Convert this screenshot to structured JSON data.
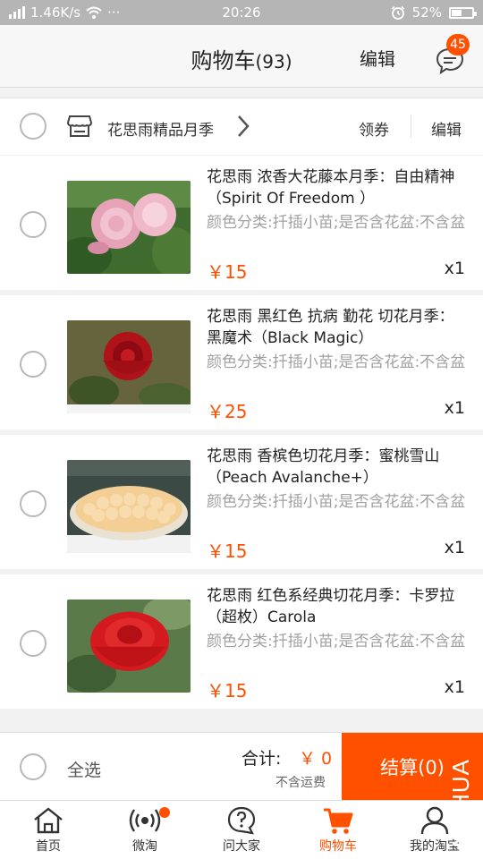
{
  "status_bar": {
    "network_speed": "1.46K/s",
    "dots": "···",
    "time": "20:26",
    "battery_percent": "52%",
    "battery_level": 0.52,
    "icons": [
      "signal-icon",
      "wifi-icon",
      "alarm-icon",
      "battery-icon"
    ]
  },
  "header": {
    "title": "购物车",
    "count": "(93)",
    "edit_label": "编辑",
    "message_badge": "45"
  },
  "shop": {
    "name": "花思雨精品月季",
    "coupon_label": "领券",
    "edit_label": "编辑"
  },
  "items": [
    {
      "title": "花思雨 浓香大花藤本月季：自由精神（Spirit Of Freedom ）",
      "sku": "颜色分类:扦插小苗;是否含花盆:不含盆",
      "price": "￥15",
      "qty": "x1",
      "image": "pink-rose-photo"
    },
    {
      "title": "花思雨 黑红色 抗病 勤花 切花月季：黑魔术（Black Magic）",
      "sku": "颜色分类:扦插小苗;是否含花盆:不含盆",
      "price": "￥25",
      "qty": "x1",
      "image": "dark-red-rose-photo"
    },
    {
      "title": "花思雨 香槟色切花月季：蜜桃雪山（Peach Avalanche+）",
      "sku": "颜色分类:扦插小苗;是否含花盆:不含盆",
      "price": "￥15",
      "qty": "x1",
      "image": "peach-rose-bouquet-photo"
    },
    {
      "title": "花思雨 红色系经典切花月季：卡罗拉（超枚）Carola",
      "sku": "颜色分类:扦插小苗;是否含花盆:不含盆",
      "price": "￥15",
      "qty": "x1",
      "image": "red-rose-photo"
    }
  ],
  "checkout": {
    "select_all_label": "全选",
    "total_label": "合计:",
    "total_value": "￥ 0",
    "shipping_note": "不含运费",
    "pay_button": "结算(0)"
  },
  "tabs": [
    {
      "label": "首页",
      "icon": "home-icon"
    },
    {
      "label": "微淘",
      "icon": "broadcast-icon"
    },
    {
      "label": "问大家",
      "icon": "question-icon"
    },
    {
      "label": "购物车",
      "icon": "cart-icon",
      "active": true
    },
    {
      "label": "我的淘宝",
      "icon": "user-icon"
    }
  ],
  "watermark": "MSHUA",
  "colors": {
    "accent": "#ff5000",
    "status_bar": "#b5b5b5",
    "background": "#f2f2f2"
  }
}
